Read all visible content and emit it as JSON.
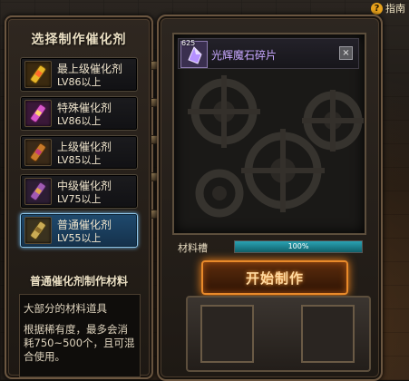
{
  "guide": {
    "label": "指南",
    "icon": "help-icon"
  },
  "left_panel": {
    "title": "选择制作催化剂",
    "categories": [
      {
        "name": "最上级催化剂",
        "level": "LV86以上",
        "icon": "golden-catalyst-icon",
        "color": "#d4a21a",
        "selected": false
      },
      {
        "name": "特殊催化剂",
        "level": "LV86以上",
        "icon": "special-catalyst-icon",
        "color": "#c44bc4",
        "selected": false
      },
      {
        "name": "上级催化剂",
        "level": "LV85以上",
        "icon": "superior-catalyst-icon",
        "color": "#c37a25",
        "selected": false
      },
      {
        "name": "中级催化剂",
        "level": "LV75以上",
        "icon": "intermediate-catalyst-icon",
        "color": "#9b5aaa",
        "selected": false
      },
      {
        "name": "普通催化剂",
        "level": "LV55以上",
        "icon": "normal-catalyst-icon",
        "color": "#c2a24c",
        "selected": true
      }
    ],
    "subtitle": "普通催化剂制作材料",
    "description": [
      "大部分的材料道具",
      "根据稀有度，最多会消耗750~500个，且可混合使用。"
    ]
  },
  "right_panel": {
    "material": {
      "count": "625",
      "name": "光辉魔石碎片",
      "icon": "radiant-crystal-icon",
      "remove_label": "×"
    },
    "slot_label": "材料槽",
    "slot_progress": "100%",
    "slot_fraction": 1.0,
    "start_button": "开始制作"
  },
  "colors": {
    "accent": "#e98a2a",
    "selected_blue": "#8fc6ea",
    "material_purple": "#c7a7ff"
  }
}
